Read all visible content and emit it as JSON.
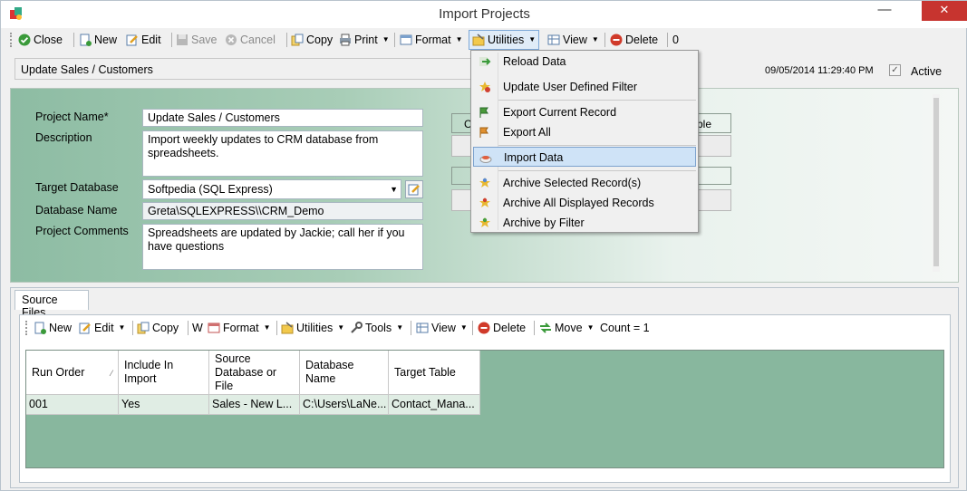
{
  "window": {
    "title": "Import Projects"
  },
  "toolbar": {
    "close": "Close",
    "new": "New",
    "edit": "Edit",
    "save": "Save",
    "cancel": "Cancel",
    "copy": "Copy",
    "print": "Print",
    "format": "Format",
    "utilities": "Utilities",
    "view": "View",
    "delete": "Delete",
    "count": "0"
  },
  "header": {
    "name": "Update Sales / Customers",
    "timestamp": "09/05/2014 11:29:40 PM",
    "active_label": "Active",
    "active_checked": "✓"
  },
  "form": {
    "project_name_label": "Project Name*",
    "project_name": "Update Sales / Customers",
    "description_label": "Description",
    "description": "Import weekly updates to CRM database from spreadsheets.",
    "target_db_label": "Target Database",
    "target_db": "Softpedia (SQL Express)",
    "db_name_label": "Database Name",
    "db_name": "Greta\\SQLEXPRESS\\\\CRM_Demo",
    "comments_label": "Project Comments",
    "comments": "Spreadsheets are updated by Jackie; call her if you have questions"
  },
  "hidden_fragments": {
    "left": "C",
    "right": "ble"
  },
  "menu": {
    "items": [
      "Reload Data",
      "Update User Defined Filter",
      "Export Current Record",
      "Export All",
      "Import Data",
      "Archive Selected Record(s)",
      "Archive All Displayed Records",
      "Archive by Filter"
    ],
    "highlighted": "Import Data"
  },
  "tabs": {
    "source_files": "Source Files"
  },
  "subtoolbar": {
    "new": "New",
    "edit": "Edit",
    "copy": "Copy",
    "w": "W",
    "format": "Format",
    "utilities": "Utilities",
    "tools": "Tools",
    "view": "View",
    "delete": "Delete",
    "move": "Move",
    "count": "Count = 1"
  },
  "grid": {
    "headers": [
      "Run Order",
      "Include In Import",
      "Source Database or File",
      "Database Name",
      "Target Table"
    ],
    "rows": [
      [
        "001",
        "Yes",
        "Sales - New L...",
        "C:\\Users\\LaNe...",
        "Contact_Mana..."
      ]
    ]
  },
  "colors": {
    "panel_green": "#8dbca3",
    "grid_green": "#88b79e",
    "highlight": "#cfe3f7"
  }
}
